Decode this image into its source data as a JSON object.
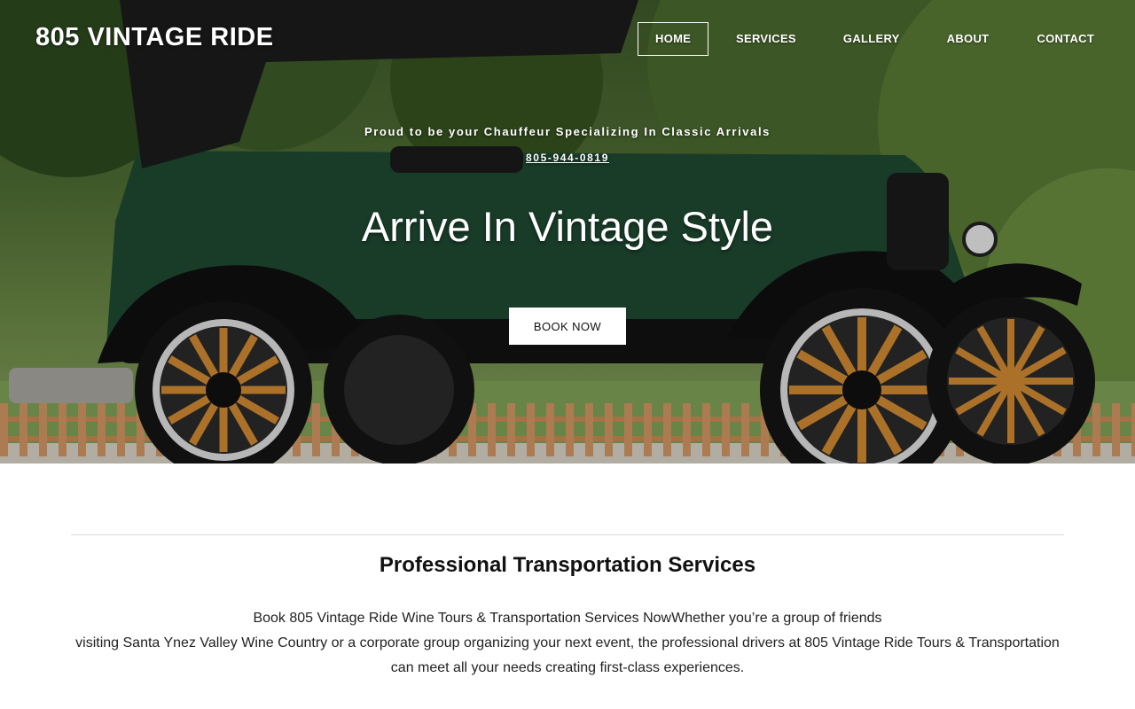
{
  "header": {
    "logo": "805 VINTAGE RIDE",
    "nav": [
      {
        "label": "HOME",
        "active": true
      },
      {
        "label": "SERVICES",
        "active": false
      },
      {
        "label": "GALLERY",
        "active": false
      },
      {
        "label": "ABOUT",
        "active": false
      },
      {
        "label": "CONTACT",
        "active": false
      }
    ]
  },
  "hero": {
    "tagline": "Proud to be your Chauffeur Specializing In Classic Arrivals",
    "phone": "805-944-0819",
    "headline": "Arrive In Vintage Style",
    "cta_label": "BOOK NOW",
    "image_subject": "green vintage touring car with wooden spoke wheels in front of trees and a white picket fence"
  },
  "services": {
    "title": "Professional Transportation Services",
    "lines": [
      "Book 805 Vintage Ride Wine Tours & Transportation Services NowWhether you’re a group of friends",
      "visiting Santa Ynez Valley Wine Country or a corporate group organizing your next event, the professional drivers at 805 Vintage Ride Tours & Transportation",
      "can meet all your needs creating first-class experiences."
    ]
  },
  "colors": {
    "car_body": "#1f4a33",
    "foliage": "#4f6d33",
    "text_on_hero": "#ffffff",
    "cta_background": "#ffffff"
  }
}
